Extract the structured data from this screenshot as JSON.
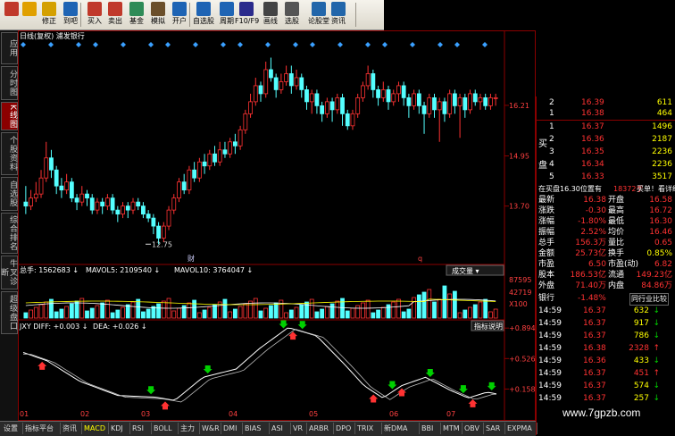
{
  "toolbar": {
    "items": [
      {
        "label": "",
        "icon": "home-icon"
      },
      {
        "label": "",
        "icon": "back-arrow-icon"
      },
      {
        "label": "修正",
        "icon": "coin-icon"
      },
      {
        "label": "到吧",
        "icon": "clock-icon"
      },
      {
        "label": "买入",
        "icon": "buy-icon"
      },
      {
        "label": "卖出",
        "icon": "sell-icon"
      },
      {
        "label": "基金",
        "icon": "fund-icon"
      },
      {
        "label": "模拟",
        "icon": "hammer-icon"
      },
      {
        "label": "开户",
        "icon": "account-icon"
      },
      {
        "label": "自选股",
        "icon": "star-icon"
      },
      {
        "label": "周期",
        "icon": "cycle-icon"
      },
      {
        "label": "F10/F9",
        "icon": "f10-icon"
      },
      {
        "label": "画线",
        "icon": "pencil-icon"
      },
      {
        "label": "选股",
        "icon": "select-icon"
      },
      {
        "label": "论股堂",
        "icon": "forum-icon"
      },
      {
        "label": "资讯",
        "icon": "news-icon"
      }
    ]
  },
  "left_tabs": [
    "应用",
    "分时图",
    "K线图",
    "个股资料",
    "自选股",
    "综合排名",
    "牛叉诊断",
    "超级盘口"
  ],
  "chart": {
    "title": "日线(复权) 浦发银行",
    "price_ticks": [
      "16.21",
      "14.95",
      "13.70"
    ],
    "low_label": "12.75",
    "marker_label": "财",
    "marker_q": "q",
    "volume_header": {
      "total": "总手: 1562683",
      "mavol5": "MAVOL5: 2109540",
      "mavol10": "MAVOL10: 3764047"
    },
    "volume_button": "成交量",
    "volume_ticks": [
      "87595",
      "42719",
      "X100"
    ],
    "macd_header": {
      "name": "JXY",
      "diff": "DIFF: +0.003",
      "dea": "DEA: +0.026"
    },
    "macd_button": "指标说明",
    "macd_ticks": [
      "+0.894",
      "+0.526",
      "+0.158"
    ],
    "month_labels": [
      "01",
      "02",
      "03",
      "04",
      "05",
      "06",
      "07"
    ]
  },
  "chart_data": {
    "type": "candlestick",
    "title": "日线(复权) 浦发银行",
    "ylim": [
      12.4,
      17.5
    ],
    "candles": [
      [
        13.8,
        13.7,
        14.2,
        13.5
      ],
      [
        13.7,
        13.9,
        14.1,
        13.6
      ],
      [
        13.9,
        14.0,
        14.3,
        13.8
      ],
      [
        14.0,
        14.4,
        14.6,
        13.9
      ],
      [
        14.4,
        14.9,
        15.3,
        14.3
      ],
      [
        14.9,
        14.6,
        15.1,
        14.4
      ],
      [
        14.6,
        14.2,
        14.7,
        14.0
      ],
      [
        14.2,
        14.1,
        14.4,
        13.9
      ],
      [
        14.1,
        14.3,
        14.5,
        14.0
      ],
      [
        14.3,
        13.9,
        14.4,
        13.8
      ],
      [
        13.9,
        13.8,
        14.0,
        13.6
      ],
      [
        13.8,
        14.0,
        14.2,
        13.7
      ],
      [
        14.0,
        13.9,
        14.1,
        13.7
      ],
      [
        13.9,
        13.6,
        14.0,
        13.5
      ],
      [
        13.6,
        13.8,
        13.9,
        13.5
      ],
      [
        13.8,
        13.7,
        13.9,
        13.5
      ],
      [
        13.7,
        13.9,
        14.0,
        13.6
      ],
      [
        13.9,
        13.6,
        14.0,
        13.5
      ],
      [
        13.6,
        13.5,
        13.7,
        13.3
      ],
      [
        13.5,
        13.7,
        13.8,
        13.4
      ],
      [
        13.7,
        13.6,
        13.8,
        13.4
      ],
      [
        13.6,
        13.8,
        13.9,
        13.5
      ],
      [
        13.8,
        13.7,
        13.9,
        13.6
      ],
      [
        13.7,
        13.5,
        13.8,
        13.4
      ],
      [
        13.5,
        13.4,
        13.6,
        13.3
      ],
      [
        13.4,
        13.2,
        13.5,
        13.0
      ],
      [
        13.2,
        12.9,
        13.3,
        12.75
      ],
      [
        12.9,
        13.2,
        13.3,
        12.8
      ],
      [
        13.2,
        13.6,
        13.7,
        13.1
      ],
      [
        13.6,
        13.9,
        14.0,
        13.5
      ],
      [
        13.9,
        14.3,
        14.4,
        13.8
      ],
      [
        14.3,
        14.1,
        14.5,
        14.0
      ],
      [
        14.1,
        14.6,
        14.7,
        14.0
      ],
      [
        14.6,
        14.4,
        14.8,
        14.3
      ],
      [
        14.4,
        14.8,
        14.9,
        14.3
      ],
      [
        14.8,
        14.7,
        15.0,
        14.5
      ],
      [
        14.7,
        15.0,
        15.1,
        14.6
      ],
      [
        15.0,
        14.8,
        15.2,
        14.7
      ],
      [
        14.8,
        15.1,
        15.3,
        14.7
      ],
      [
        15.1,
        15.0,
        15.3,
        14.9
      ],
      [
        15.0,
        15.3,
        15.4,
        14.9
      ],
      [
        15.3,
        15.2,
        15.5,
        15.0
      ],
      [
        15.2,
        15.6,
        15.7,
        15.1
      ],
      [
        15.6,
        16.0,
        16.1,
        15.5
      ],
      [
        16.0,
        16.3,
        16.5,
        15.9
      ],
      [
        16.3,
        16.7,
        16.9,
        16.2
      ],
      [
        16.7,
        16.5,
        16.8,
        16.3
      ],
      [
        16.5,
        17.1,
        17.3,
        16.4
      ],
      [
        17.1,
        16.9,
        17.4,
        16.8
      ],
      [
        16.9,
        16.6,
        17.0,
        16.4
      ],
      [
        16.6,
        16.8,
        17.0,
        16.5
      ],
      [
        16.8,
        17.0,
        17.2,
        16.7
      ],
      [
        17.0,
        16.7,
        17.2,
        16.5
      ],
      [
        16.7,
        16.9,
        17.1,
        16.6
      ],
      [
        16.9,
        16.6,
        17.0,
        16.4
      ],
      [
        16.6,
        16.3,
        16.7,
        16.1
      ],
      [
        16.3,
        16.5,
        16.6,
        16.0
      ],
      [
        16.5,
        16.2,
        16.6,
        16.0
      ],
      [
        16.2,
        16.0,
        16.3,
        15.8
      ],
      [
        16.0,
        16.3,
        16.4,
        15.9
      ],
      [
        16.3,
        16.1,
        16.4,
        15.8
      ],
      [
        16.1,
        16.4,
        16.5,
        16.0
      ],
      [
        16.4,
        16.0,
        16.5,
        15.7
      ],
      [
        16.0,
        15.7,
        16.1,
        15.6
      ],
      [
        15.7,
        16.0,
        16.1,
        15.6
      ],
      [
        16.0,
        16.4,
        16.5,
        15.9
      ],
      [
        16.4,
        16.7,
        16.8,
        16.3
      ],
      [
        16.7,
        17.0,
        17.2,
        16.6
      ],
      [
        17.0,
        16.6,
        17.1,
        16.4
      ],
      [
        16.6,
        16.4,
        16.7,
        16.2
      ],
      [
        16.4,
        16.6,
        16.8,
        16.3
      ],
      [
        16.6,
        16.3,
        16.7,
        16.1
      ],
      [
        16.3,
        16.5,
        16.6,
        16.2
      ],
      [
        16.5,
        16.7,
        16.8,
        16.3
      ],
      [
        16.7,
        16.4,
        16.8,
        16.2
      ],
      [
        16.4,
        16.2,
        16.5,
        15.9
      ],
      [
        16.2,
        16.5,
        16.6,
        16.1
      ],
      [
        16.5,
        16.2,
        16.6,
        16.0
      ],
      [
        16.2,
        16.0,
        16.3,
        15.5
      ],
      [
        16.0,
        16.4,
        16.5,
        15.9
      ],
      [
        16.4,
        16.1,
        16.5,
        15.9
      ],
      [
        16.1,
        16.3,
        16.4,
        15.3
      ],
      [
        16.3,
        16.0,
        16.4,
        15.8
      ],
      [
        16.0,
        16.5,
        16.6,
        15.9
      ],
      [
        16.5,
        16.2,
        16.6,
        16.0
      ],
      [
        16.2,
        16.4,
        16.5,
        15.4
      ],
      [
        16.4,
        16.1,
        16.5,
        15.9
      ],
      [
        16.1,
        16.5,
        16.6,
        16.0
      ],
      [
        16.5,
        16.3,
        16.6,
        16.2
      ],
      [
        16.3,
        16.4,
        16.5,
        16.1
      ],
      [
        16.4,
        16.2,
        16.5,
        16.1
      ],
      [
        16.2,
        16.4,
        16.5,
        16.1
      ],
      [
        16.4,
        16.4,
        16.5,
        16.2
      ]
    ],
    "macd": {
      "diff_last": 0.003,
      "dea_last": 0.026,
      "ylim": [
        -0.15,
        0.95
      ]
    }
  },
  "quote": {
    "sell_rows": [
      {
        "lvl": "2",
        "price": "16.39",
        "vol": "611"
      },
      {
        "lvl": "1",
        "price": "16.38",
        "vol": "464"
      }
    ],
    "buy_label_top": "买",
    "buy_label_bottom": "盘",
    "buy_rows": [
      {
        "lvl": "1",
        "price": "16.37",
        "vol": "1496"
      },
      {
        "lvl": "2",
        "price": "16.36",
        "vol": "2187"
      },
      {
        "lvl": "3",
        "price": "16.35",
        "vol": "2236"
      },
      {
        "lvl": "4",
        "price": "16.34",
        "vol": "2236"
      },
      {
        "lvl": "5",
        "price": "16.33",
        "vol": "3517"
      }
    ],
    "pending": {
      "text": "在买盘16.30位置有",
      "num": "18372手",
      "detail": "买单！看详细"
    },
    "stats": [
      {
        "l1": "最新",
        "v1": "16.38",
        "l2": "开盘",
        "v2": "16.58"
      },
      {
        "l1": "涨跌",
        "v1": "-0.30",
        "l2": "最高",
        "v2": "16.72"
      },
      {
        "l1": "涨幅",
        "v1": "-1.80%",
        "l2": "最低",
        "v2": "16.30"
      },
      {
        "l1": "振幅",
        "v1": "2.52%",
        "l2": "均价",
        "v2": "16.46"
      },
      {
        "l1": "总手",
        "v1": "156.3万",
        "l2": "量比",
        "v2": "0.65"
      },
      {
        "l1": "金额",
        "v1": "25.73亿",
        "l2": "换手",
        "v2": "0.85%"
      },
      {
        "l1": "市盈",
        "v1": "6.50",
        "l2": "市盈(动)",
        "v2": "6.82"
      },
      {
        "l1": "股本",
        "v1": "186.53亿",
        "l2": "流通",
        "v2": "149.23亿"
      },
      {
        "l1": "外盘",
        "v1": "71.40万",
        "l2": "内盘",
        "v2": "84.86万"
      }
    ],
    "industry": {
      "name": "银行",
      "change": "-1.48%",
      "compare": "同行业比较"
    },
    "ticks": [
      {
        "t": "14:59",
        "p": "16.37",
        "v": "632",
        "d": "down"
      },
      {
        "t": "14:59",
        "p": "16.37",
        "v": "917",
        "d": "down"
      },
      {
        "t": "14:59",
        "p": "16.37",
        "v": "786",
        "d": "down"
      },
      {
        "t": "14:59",
        "p": "16.38",
        "v": "2328",
        "d": "up"
      },
      {
        "t": "14:59",
        "p": "16.36",
        "v": "433",
        "d": "down"
      },
      {
        "t": "14:59",
        "p": "16.37",
        "v": "451",
        "d": "up"
      },
      {
        "t": "14:59",
        "p": "16.37",
        "v": "574",
        "d": "down"
      },
      {
        "t": "14:59",
        "p": "16.37",
        "v": "257",
        "d": "down"
      }
    ]
  },
  "bottom_tabs": [
    "设置",
    "指标平台",
    "资讯",
    "MACD",
    "KDJ",
    "RSI",
    "BOLL",
    "主力",
    "W&R",
    "DMI",
    "BIAS",
    "ASI",
    "VR",
    "ARBR",
    "DPO",
    "TRIX",
    "新DMA",
    "BBI",
    "MTM",
    "OBV",
    "SAR",
    "EXPMA"
  ],
  "watermark": "www.7gpzb.com",
  "colors": {
    "up": "#ff3232",
    "down": "#54ffff",
    "accent_red": "#8b0000",
    "yellow": "#ffff00",
    "arrow_green": "#00d000"
  }
}
